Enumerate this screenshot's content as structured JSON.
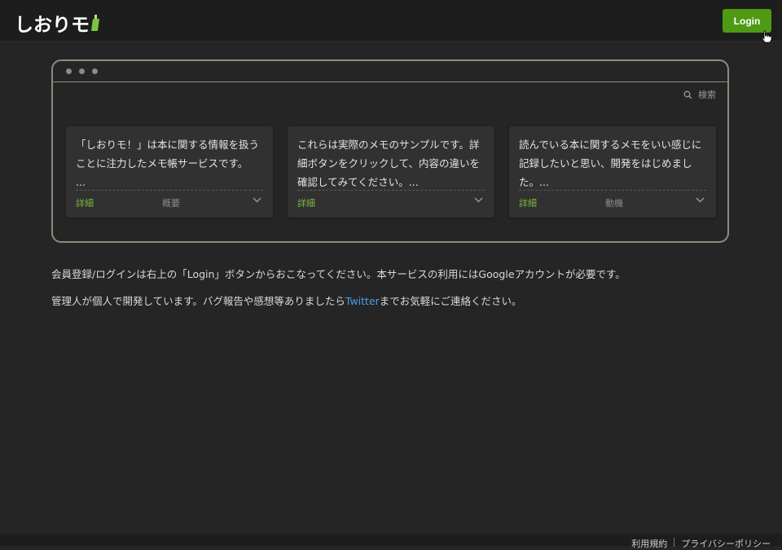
{
  "header": {
    "logo_text": "しおりモ",
    "login_label": "Login",
    "accent": "#4e9a14"
  },
  "demo": {
    "search_label": "検索",
    "cards": [
      {
        "text": "「しおりモ！」は本に関する情報を扱うことに注力したメモ帳サービスです。\n...",
        "detail_label": "詳細",
        "tag": "概要"
      },
      {
        "text": "これらは実際のメモのサンプルです。詳細ボタンをクリックして、内容の違いを確認してみてください。...",
        "detail_label": "詳細",
        "tag": ""
      },
      {
        "text": "読んでいる本に関するメモをいい感じに記録したいと思い、開発をはじめました。...",
        "detail_label": "詳細",
        "tag": "動機"
      }
    ]
  },
  "info": {
    "line1": "会員登録/ログインは右上の「Login」ボタンからおこなってください。本サービスの利用にはGoogleアカウントが必要です。",
    "line2_before": "管理人が個人で開発しています。バグ報告や感想等ありましたら",
    "line2_link": "Twitter",
    "line2_after": "までお気軽にご連絡ください。"
  },
  "footer": {
    "terms": "利用規約",
    "privacy": "プライバシーポリシー"
  }
}
